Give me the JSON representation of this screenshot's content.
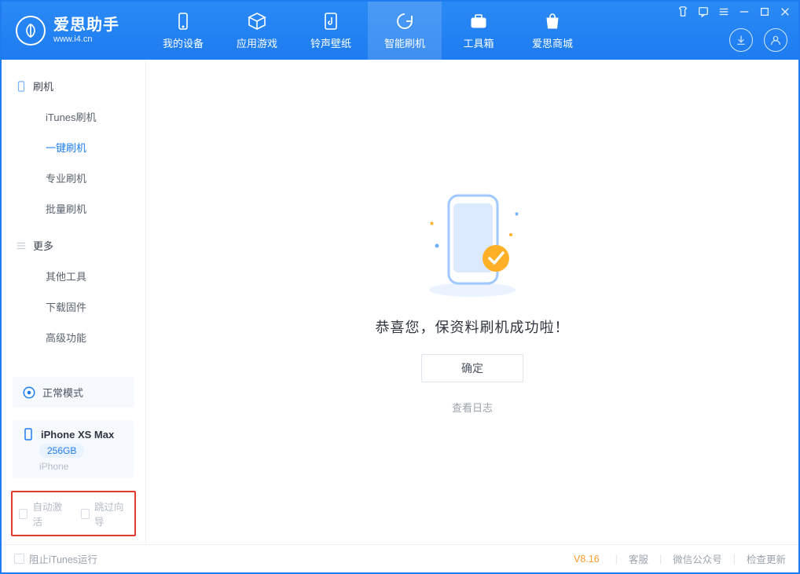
{
  "app": {
    "title": "爱思助手",
    "subtitle": "www.i4.cn"
  },
  "nav": {
    "items": [
      {
        "label": "我的设备"
      },
      {
        "label": "应用游戏"
      },
      {
        "label": "铃声壁纸"
      },
      {
        "label": "智能刷机"
      },
      {
        "label": "工具箱"
      },
      {
        "label": "爱思商城"
      }
    ]
  },
  "sidebar": {
    "group_flash": {
      "title": "刷机",
      "items": [
        {
          "label": "iTunes刷机"
        },
        {
          "label": "一键刷机"
        },
        {
          "label": "专业刷机"
        },
        {
          "label": "批量刷机"
        }
      ]
    },
    "group_more": {
      "title": "更多",
      "items": [
        {
          "label": "其他工具"
        },
        {
          "label": "下载固件"
        },
        {
          "label": "高级功能"
        }
      ]
    },
    "mode": "正常模式",
    "device": {
      "name": "iPhone XS Max",
      "storage": "256GB",
      "type": "iPhone"
    },
    "options": {
      "auto_activate": "自动激活",
      "skip_wizard": "跳过向导"
    }
  },
  "main": {
    "success_text": "恭喜您，保资料刷机成功啦！",
    "ok_button": "确定",
    "view_log": "查看日志"
  },
  "footer": {
    "stop_itunes": "阻止iTunes运行",
    "version": "V8.16",
    "links": {
      "support": "客服",
      "wechat": "微信公众号",
      "update": "检查更新"
    }
  }
}
